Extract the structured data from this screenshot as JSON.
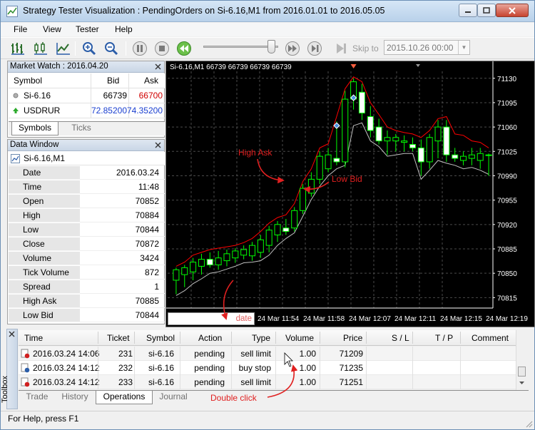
{
  "window": {
    "title": "Strategy Tester Visualization : PendingOrders on Si-6.16,M1 from 2016.01.01 to 2016.05.05"
  },
  "menu": [
    "File",
    "View",
    "Tester",
    "Help"
  ],
  "toolbar": {
    "skip_label": "Skip to",
    "skip_date": "2015.10.26 00:00"
  },
  "market_watch": {
    "title": "Market Watch : 2016.04.20",
    "columns": [
      "Symbol",
      "Bid",
      "Ask"
    ],
    "rows": [
      {
        "symbol": "Si-6.16",
        "bid": "66739",
        "ask": "66700"
      },
      {
        "symbol": "USDRUR",
        "bid": "72.85200",
        "ask": "74.35200"
      }
    ],
    "tabs": [
      "Symbols",
      "Ticks"
    ]
  },
  "data_window": {
    "title": "Data Window",
    "symbol": "Si-6.16,M1",
    "rows": [
      {
        "label": "Date",
        "value": "2016.03.24"
      },
      {
        "label": "Time",
        "value": "11:48"
      },
      {
        "label": "Open",
        "value": "70852"
      },
      {
        "label": "High",
        "value": "70884"
      },
      {
        "label": "Low",
        "value": "70844"
      },
      {
        "label": "Close",
        "value": "70872"
      },
      {
        "label": "Volume",
        "value": "3424"
      },
      {
        "label": "Tick Volume",
        "value": "872"
      },
      {
        "label": "Spread",
        "value": "1"
      },
      {
        "label": "High Ask",
        "value": "70885"
      },
      {
        "label": "Low Bid",
        "value": "70844"
      }
    ]
  },
  "chart": {
    "header": "Si-6.16,M1  66739 66739 66739 66739",
    "date_field_label": "date",
    "price_labels": [
      "71130",
      "71095",
      "71060",
      "71025",
      "70990",
      "70955",
      "70920",
      "70885",
      "70850",
      "70815"
    ],
    "time_labels": [
      "24 Mar 11:54",
      "24 Mar 11:58",
      "24 Mar 12:07",
      "24 Mar 12:11",
      "24 Mar 12:15",
      "24 Mar 12:19"
    ],
    "annotations": {
      "high_ask": "High Ask",
      "low_bid": "Low Bid"
    },
    "colors": {
      "background": "#000000",
      "grid": "#4a4a4a",
      "candle": "#00ff00",
      "ask_line": "#ff0000",
      "bid_line": "#c0c0c0"
    }
  },
  "chart_data": {
    "type": "candlestick",
    "ylim": [
      70800,
      71140
    ],
    "candles": [
      {
        "o": 70840,
        "h": 70858,
        "l": 70820,
        "c": 70855
      },
      {
        "o": 70848,
        "h": 70862,
        "l": 70830,
        "c": 70858
      },
      {
        "o": 70852,
        "h": 70872,
        "l": 70840,
        "c": 70866
      },
      {
        "o": 70860,
        "h": 70878,
        "l": 70848,
        "c": 70870
      },
      {
        "o": 70870,
        "h": 70880,
        "l": 70858,
        "c": 70862
      },
      {
        "o": 70862,
        "h": 70882,
        "l": 70855,
        "c": 70872
      },
      {
        "o": 70868,
        "h": 70884,
        "l": 70860,
        "c": 70878
      },
      {
        "o": 70872,
        "h": 70886,
        "l": 70865,
        "c": 70882
      },
      {
        "o": 70876,
        "h": 70890,
        "l": 70870,
        "c": 70884
      },
      {
        "o": 70875,
        "h": 70895,
        "l": 70868,
        "c": 70890
      },
      {
        "o": 70880,
        "h": 70905,
        "l": 70872,
        "c": 70898
      },
      {
        "o": 70890,
        "h": 70918,
        "l": 70880,
        "c": 70912
      },
      {
        "o": 70905,
        "h": 70925,
        "l": 70895,
        "c": 70920
      },
      {
        "o": 70915,
        "h": 70928,
        "l": 70905,
        "c": 70910
      },
      {
        "o": 70915,
        "h": 70945,
        "l": 70910,
        "c": 70940
      },
      {
        "o": 70940,
        "h": 70978,
        "l": 70935,
        "c": 70972
      },
      {
        "o": 70965,
        "h": 70995,
        "l": 70960,
        "c": 70985
      },
      {
        "o": 70985,
        "h": 71025,
        "l": 70978,
        "c": 71018
      },
      {
        "o": 71000,
        "h": 71030,
        "l": 70995,
        "c": 71020
      },
      {
        "o": 71015,
        "h": 71068,
        "l": 71005,
        "c": 71010
      },
      {
        "o": 71010,
        "h": 71112,
        "l": 71002,
        "c": 71100
      },
      {
        "o": 71100,
        "h": 71130,
        "l": 71085,
        "c": 71125
      },
      {
        "o": 71110,
        "h": 71122,
        "l": 71070,
        "c": 71080
      },
      {
        "o": 71075,
        "h": 71090,
        "l": 71045,
        "c": 71055
      },
      {
        "o": 71060,
        "h": 71072,
        "l": 71035,
        "c": 71040
      },
      {
        "o": 71040,
        "h": 71055,
        "l": 71020,
        "c": 71045
      },
      {
        "o": 71040,
        "h": 71050,
        "l": 71025,
        "c": 71045
      },
      {
        "o": 71038,
        "h": 71048,
        "l": 71025,
        "c": 71040
      },
      {
        "o": 71035,
        "h": 71045,
        "l": 71025,
        "c": 71030
      },
      {
        "o": 71030,
        "h": 71042,
        "l": 70990,
        "c": 71010
      },
      {
        "o": 71010,
        "h": 71050,
        "l": 71000,
        "c": 71045
      },
      {
        "o": 71040,
        "h": 71070,
        "l": 71015,
        "c": 71060
      },
      {
        "o": 71060,
        "h": 71070,
        "l": 71010,
        "c": 71020
      },
      {
        "o": 71020,
        "h": 71030,
        "l": 71010,
        "c": 71015
      },
      {
        "o": 71012,
        "h": 71025,
        "l": 71005,
        "c": 71018
      },
      {
        "o": 71015,
        "h": 71030,
        "l": 71005,
        "c": 71020
      },
      {
        "o": 71012,
        "h": 71030,
        "l": 71000,
        "c": 71022
      },
      {
        "o": 71020,
        "h": 71022,
        "l": 70990,
        "c": 71020
      }
    ],
    "ask_line": [
      70860,
      70866,
      70876,
      70880,
      70884,
      70886,
      70888,
      70890,
      70894,
      70900,
      70910,
      70922,
      70930,
      70934,
      70950,
      70982,
      71000,
      71030,
      71036,
      71075,
      71115,
      71132,
      71125,
      71095,
      71078,
      71060,
      71055,
      71052,
      71050,
      71045,
      71055,
      71072,
      71075,
      71050,
      71048,
      71040,
      71038,
      71030
    ],
    "bid_line": [
      70818,
      70825,
      70835,
      70842,
      70850,
      70852,
      70856,
      70860,
      70865,
      70866,
      70868,
      70876,
      70890,
      70900,
      70908,
      70932,
      70956,
      70975,
      70990,
      71000,
      71005,
      71062,
      71066,
      71040,
      71032,
      71018,
      71020,
      71022,
      71022,
      70985,
      70998,
      71012,
      71008,
      71005,
      71000,
      71002,
      70998,
      70992
    ]
  },
  "toolbox": {
    "label": "Toolbox",
    "columns": [
      "Time",
      "Ticket",
      "Symbol",
      "Action",
      "Type",
      "Volume",
      "Price",
      "S / L",
      "T / P",
      "Comment"
    ],
    "rows": [
      {
        "time": "2016.03.24 14:06",
        "ticket": "231",
        "symbol": "si-6.16",
        "action": "pending",
        "type": "sell limit",
        "volume": "1.00",
        "price": "71209"
      },
      {
        "time": "2016.03.24 14:12",
        "ticket": "232",
        "symbol": "si-6.16",
        "action": "pending",
        "type": "buy stop",
        "volume": "1.00",
        "price": "71235"
      },
      {
        "time": "2016.03.24 14:12",
        "ticket": "233",
        "symbol": "si-6.16",
        "action": "pending",
        "type": "sell limit",
        "volume": "1.00",
        "price": "71251"
      }
    ],
    "tabs": [
      "Trade",
      "History",
      "Operations",
      "Journal"
    ],
    "annotation": "Double click"
  },
  "status": {
    "text": "For Help, press F1"
  }
}
